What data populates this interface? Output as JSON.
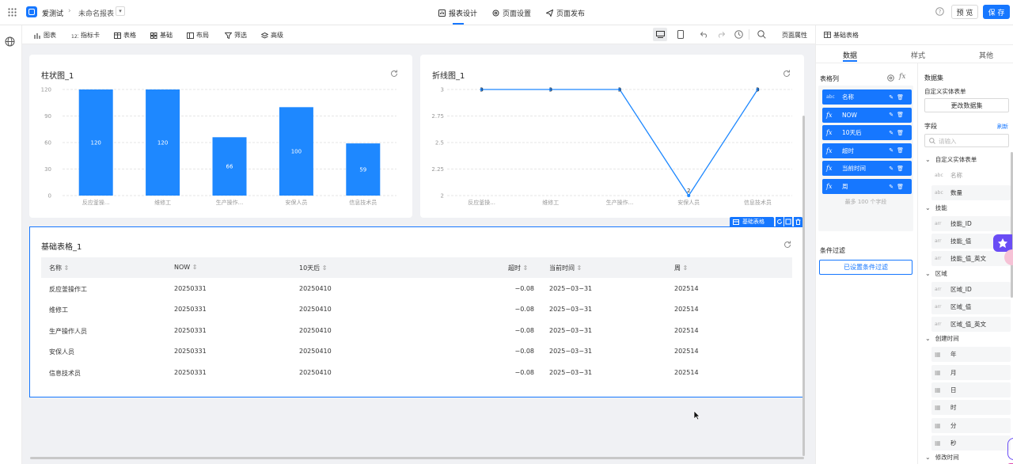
{
  "topbar": {
    "app_name": "爱测试",
    "report_name": "未命名报表",
    "tabs": [
      {
        "label": "报表设计",
        "icon": "report-design-icon",
        "active": true
      },
      {
        "label": "页面设置",
        "icon": "gear-icon",
        "active": false
      },
      {
        "label": "页面发布",
        "icon": "send-icon",
        "active": false
      }
    ],
    "preview_label": "预 览",
    "save_label": "保 存"
  },
  "toolbar": {
    "items": [
      {
        "label": "图表",
        "icon": "chart-icon"
      },
      {
        "label": "指标卡",
        "icon": "metric-card-icon"
      },
      {
        "label": "表格",
        "icon": "table-icon"
      },
      {
        "label": "基础",
        "icon": "basic-icon"
      },
      {
        "label": "布局",
        "icon": "layout-icon"
      },
      {
        "label": "筛选",
        "icon": "filter-icon"
      },
      {
        "label": "高级",
        "icon": "advanced-icon"
      }
    ],
    "page_props_label": "页面属性"
  },
  "bar_card": {
    "title": "柱状图_1"
  },
  "line_card": {
    "title": "折线图_1"
  },
  "chart_data": [
    {
      "type": "bar",
      "title": "柱状图_1",
      "categories": [
        "反应釜操...",
        "维修工",
        "生产操作...",
        "安保人员",
        "信息技术员"
      ],
      "values": [
        120,
        120,
        66,
        100,
        59
      ],
      "yticks": [
        "0",
        "30",
        "60",
        "90",
        "120"
      ],
      "ylim": [
        0,
        120
      ],
      "grid": true,
      "color": "#1e88ff"
    },
    {
      "type": "line",
      "title": "折线图_1",
      "categories": [
        "反应釜操...",
        "维修工",
        "生产操作...",
        "安保人员",
        "信息技术员"
      ],
      "values": [
        3,
        3,
        3,
        2,
        3
      ],
      "yticks": [
        "2",
        "2.25",
        "2.5",
        "2.75",
        "3"
      ],
      "ylim": [
        2,
        3
      ],
      "grid": true,
      "color": "#1e88ff"
    }
  ],
  "table_card": {
    "title": "基础表格_1",
    "badge_label": "基础表格",
    "columns": [
      "名称",
      "NOW",
      "10天后",
      "超时",
      "当前时间",
      "周"
    ],
    "rows": [
      [
        "反应釜操作工",
        "20250331",
        "20250410",
        "−0.08",
        "2025−03−31",
        "202514"
      ],
      [
        "维修工",
        "20250331",
        "20250410",
        "−0.08",
        "2025−03−31",
        "202514"
      ],
      [
        "生产操作人员",
        "20250331",
        "20250410",
        "−0.08",
        "2025−03−31",
        "202514"
      ],
      [
        "安保人员",
        "20250331",
        "20250410",
        "−0.08",
        "2025−03−31",
        "202514"
      ],
      [
        "信息技术员",
        "20250331",
        "20250410",
        "−0.08",
        "2025−03−31",
        "202514"
      ]
    ]
  },
  "panel": {
    "header": "基础表格",
    "tabs": [
      "数据",
      "样式",
      "其他"
    ],
    "active_tab": "数据",
    "table_cols_label": "表格列",
    "table_cols": [
      {
        "type": "abc",
        "label": "名称"
      },
      {
        "type": "fx",
        "label": "NOW"
      },
      {
        "type": "fx",
        "label": "10天后"
      },
      {
        "type": "fx",
        "label": "超时"
      },
      {
        "type": "fx",
        "label": "当前时间"
      },
      {
        "type": "fx",
        "label": "周"
      }
    ],
    "max_hint": "最多 100 个字段",
    "filter_label": "条件过滤",
    "filter_button": "已设置条件过滤",
    "dataset_label": "数据集",
    "dataset_name": "自定义实体表单",
    "change_dataset": "更改数据集",
    "fields_label": "字段",
    "refresh_label": "刷新",
    "search_placeholder": "请输入",
    "tree_root": "自定义实体表单",
    "root_fields": [
      {
        "type": "abc",
        "label": "名称"
      },
      {
        "type": "abc",
        "label": "数量"
      }
    ],
    "group_skill": "技能",
    "skill_fields": [
      {
        "type": "arr",
        "label": "技能_ID"
      },
      {
        "type": "arr",
        "label": "技能_值"
      },
      {
        "type": "arr",
        "label": "技能_值_英文"
      }
    ],
    "group_region": "区域",
    "region_fields": [
      {
        "type": "arr",
        "label": "区域_ID"
      },
      {
        "type": "arr",
        "label": "区域_值"
      },
      {
        "type": "arr",
        "label": "区域_值_英文"
      }
    ],
    "group_created": "创建时间",
    "time_fields": [
      "年",
      "月",
      "日",
      "时",
      "分",
      "秒"
    ],
    "group_modified": "修改时间"
  }
}
